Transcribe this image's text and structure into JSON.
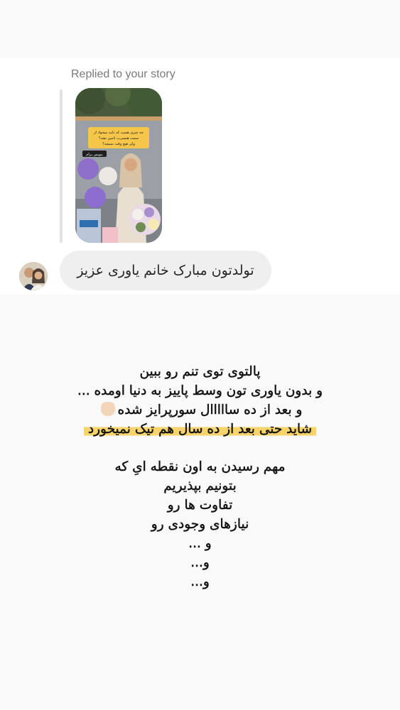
{
  "reply_header": "Replied to your story",
  "story_thumbnail": {
    "question_text": "چه چیزی هست که دلت میخواد از سمت همسرت تامین بشه؟ ولی هیچ وقت نمیشه؟",
    "answer_label": "بنویس برام"
  },
  "message": {
    "text": "تولدتون مبارک خانم یاوری عزیز"
  },
  "caption": {
    "lines": [
      "پالتوی توی تنم رو ببین",
      "و بدون یاوری تون وسط پاییز به دنیا اومده ...",
      "و بعد از ده سااااال سورپرایز شده",
      "شاید حتی بعد از ده سال هم تیک نمیخورد",
      "مهم رسیدن به اون نقطه ایِ که",
      "بتونیم بپذیریم",
      "تفاوت ها رو",
      "نیازهای وجودی رو",
      "و ...",
      "و...",
      "و..."
    ]
  },
  "colors": {
    "highlight": "#f7d46b",
    "bubble": "#efefef",
    "page_bg": "#f9f9f9",
    "secondary_text": "#7a7a7a"
  },
  "icons": [
    "raised-hand-emoji"
  ]
}
